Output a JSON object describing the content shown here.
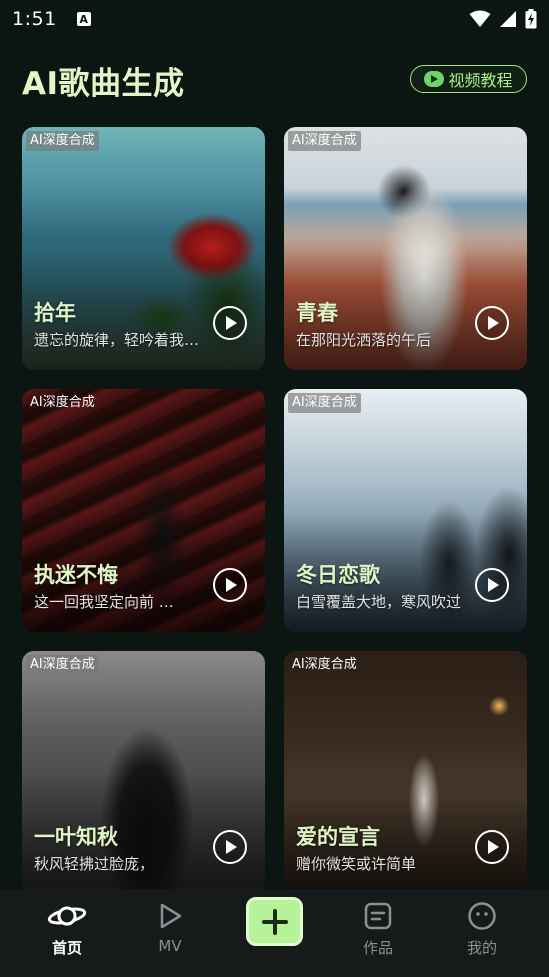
{
  "status_bar": {
    "time": "1:51",
    "indicator": "A",
    "icons": [
      "wifi-icon",
      "signal-icon",
      "battery-charging-icon"
    ]
  },
  "header": {
    "title": "AI歌曲生成",
    "tutorial_label": "视频教程",
    "tutorial_icon": "video-chat-icon"
  },
  "cards": [
    {
      "tag": "AI深度合成",
      "title": "拾年",
      "desc": "遗忘的旋律，轻吟着我们的过往"
    },
    {
      "tag": "AI深度合成",
      "title": "青春",
      "desc": "在那阳光洒落的午后"
    },
    {
      "tag": "AI深度合成",
      "title": "执迷不悔",
      "desc": "这一回我坚定向前 …"
    },
    {
      "tag": "AI深度合成",
      "title": "冬日恋歌",
      "desc": "白雪覆盖大地，寒风吹过"
    },
    {
      "tag": "AI深度合成",
      "title": "一叶知秋",
      "desc": "秋风轻拂过脸庞，"
    },
    {
      "tag": "AI深度合成",
      "title": "爱的宣言",
      "desc": "赠你微笑或许简单"
    }
  ],
  "bottom_nav": {
    "items": [
      {
        "label": "首页",
        "icon": "planet-icon",
        "active": true
      },
      {
        "label": "MV",
        "icon": "play-outline-icon",
        "active": false
      },
      {
        "label": "",
        "icon": "plus-icon",
        "active": false
      },
      {
        "label": "作品",
        "icon": "document-icon",
        "active": false
      },
      {
        "label": "我的",
        "icon": "smiley-icon",
        "active": false
      }
    ]
  },
  "colors": {
    "accent_green": "#a9ef8a",
    "title_green": "#e6f5c8",
    "create_button": "#b6f29a",
    "background": "#0b1512",
    "nav_background": "#171a1b"
  }
}
